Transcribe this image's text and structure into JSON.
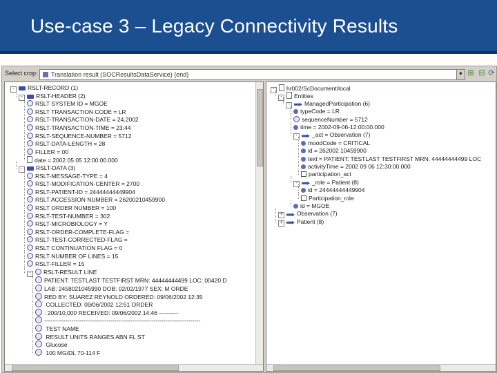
{
  "slide": {
    "title": "Use-case 3 – Legacy Connectivity Results"
  },
  "toolbar": {
    "label": "Select crop:",
    "combo_value": "Translation result (SOCResultsDataService) (end)"
  },
  "left_tree": [
    {
      "text": "RSLT-RECORD (1)",
      "icon": "segment-icon",
      "depth": 0,
      "toggle": "-"
    },
    {
      "text": "RSLT-HEADER (2)",
      "icon": "segment-icon",
      "depth": 1,
      "toggle": "-"
    },
    {
      "text": "RSLT SYSTEM ID = MGOE",
      "icon": "field-icon",
      "depth": 2
    },
    {
      "text": "RSLT TRANSACTION CODE = LR",
      "icon": "field-icon",
      "depth": 2
    },
    {
      "text": "RSLT-TRANSACTION-DATE = 24.2002",
      "icon": "field-icon",
      "depth": 2
    },
    {
      "text": "RSLT-TRANSACTION-TIME = 23:44",
      "icon": "field-icon",
      "depth": 2
    },
    {
      "text": "RSLT-SEQUENCE-NUMBER = 5712",
      "icon": "field-icon",
      "depth": 2
    },
    {
      "text": "RSLT-DATA-LENGTH = 28",
      "icon": "field-icon",
      "depth": 2
    },
    {
      "text": "FILLER =          00",
      "icon": "field-icon",
      "depth": 2
    },
    {
      "text": "date = 2002 05 05 12:00:00.000",
      "icon": "file-icon",
      "depth": 2
    },
    {
      "text": "RSLT-DATA (3)",
      "icon": "segment-icon",
      "depth": 1,
      "toggle": "-"
    },
    {
      "text": "RSLT-MESSAGE-TYPE = 4",
      "icon": "field-icon",
      "depth": 2
    },
    {
      "text": "RSLT-MODIFICATION-CENTER = 2700",
      "icon": "field-icon",
      "depth": 2
    },
    {
      "text": "RSLT-PATIENT-ID = 24444444449904",
      "icon": "field-icon",
      "depth": 2
    },
    {
      "text": "RSLT ACCESSION NUMBER = 26200210459900",
      "icon": "field-icon",
      "depth": 2
    },
    {
      "text": "RSLT ORDER NUMBER = 100",
      "icon": "field-icon",
      "depth": 2
    },
    {
      "text": "RSLT-TEST-NUMBER = 302",
      "icon": "field-icon",
      "depth": 2
    },
    {
      "text": "RSLT-MICROBIOLOGY = Y",
      "icon": "field-icon",
      "depth": 2
    },
    {
      "text": "RSLT-ORDER-COMPLETE-FLAG =",
      "icon": "field-icon",
      "depth": 2
    },
    {
      "text": "RSLT-TEST-CORRECTED-FLAG =",
      "icon": "field-icon",
      "depth": 2
    },
    {
      "text": "RSLT CONTINUATION FLAG = 0",
      "icon": "field-icon",
      "depth": 2
    },
    {
      "text": "RSLT NUMBER OF LINES = 15",
      "icon": "field-icon",
      "depth": 2
    },
    {
      "text": "RSLT-FILLER = 15",
      "icon": "field-icon",
      "depth": 2
    },
    {
      "text": "RSLT-RESULT LINE",
      "icon": "field-icon",
      "depth": 2,
      "toggle": "-"
    },
    {
      "text": "PATIENT: TESTLAST TESTFIRST                MRN: 44444444499 LOC: 00420      D",
      "icon": "ab-icon",
      "depth": 3
    },
    {
      "text": "LAB: 2458021045990          DOB: 02/02/1977 SEX: M          ORDE",
      "icon": "ab-icon",
      "depth": 3
    },
    {
      "text": "RED BY: SUAREZ REYNOLD          ORDERED: 09/06/2002 12:35",
      "icon": "ab-icon",
      "depth": 3
    },
    {
      "text": "                    COLLECTED: 09/06/2002 12:51         ORDER",
      "icon": "ab-icon",
      "depth": 3
    },
    {
      "text": ": 200/10,000                  RECEIVED: 09/06/2002 14:46           ----------",
      "icon": "ab-icon",
      "depth": 3
    },
    {
      "text": "--------------------------------------------------------------------------------",
      "icon": "ab-icon",
      "depth": 3
    },
    {
      "text": "                                       TEST NAME",
      "icon": "ab-icon",
      "depth": 3
    },
    {
      "text": "      RESULT             UNITS   RANGES   ABN FL ST",
      "icon": "ab-icon",
      "depth": 3
    },
    {
      "text": "                                         Glucose",
      "icon": "ab-icon",
      "depth": 3
    },
    {
      "text": "      100              MG/DL   70-114           F",
      "icon": "ab-icon",
      "depth": 3
    }
  ],
  "right_tree": [
    {
      "text": "hr002/ScDocument/local",
      "icon": "file-icon",
      "depth": 0,
      "toggle": "-"
    },
    {
      "text": "Entities",
      "icon": "file-icon",
      "depth": 1,
      "toggle": "-"
    },
    {
      "text": "ManagedParticipation (6)",
      "icon": "arrow-icon",
      "depth": 2,
      "toggle": "-"
    },
    {
      "text": "typeCode = LR",
      "icon": "dot-icon",
      "depth": 3
    },
    {
      "text": "sequenceNumber = 5712",
      "icon": "field-icon",
      "depth": 3
    },
    {
      "text": "time = 2002-09-06-12:00:00.000",
      "icon": "dot-icon",
      "depth": 3
    },
    {
      "text": "_act = Observation (7)",
      "icon": "arrow-icon",
      "depth": 3,
      "toggle": "-"
    },
    {
      "text": "moodCode = CRITICAL",
      "icon": "dot-icon",
      "depth": 4
    },
    {
      "text": "id = 262002 10459900",
      "icon": "dot-icon",
      "depth": 4
    },
    {
      "text": "text = PATIENT: TESTLAST TESTFIRST               MRN: 44444444499 LOC",
      "icon": "dot-icon",
      "depth": 4
    },
    {
      "text": "activityTime = 2002 09 06 12:30:00.000",
      "icon": "dot-icon",
      "depth": 4
    },
    {
      "text": "participation_act",
      "icon": "square-icon",
      "depth": 4
    },
    {
      "text": "_role = Patient (8)",
      "icon": "arrow-icon",
      "depth": 3,
      "toggle": "-"
    },
    {
      "text": "id = 24444444449904",
      "icon": "dot-icon",
      "depth": 4
    },
    {
      "text": "Participation_role",
      "icon": "square-icon",
      "depth": 4
    },
    {
      "text": "id = MGOE",
      "icon": "dot-icon",
      "depth": 3
    },
    {
      "text": "Observation (7)",
      "icon": "arrow-icon",
      "depth": 1,
      "toggle": "+"
    },
    {
      "text": "Patient (8)",
      "icon": "arrow-icon",
      "depth": 1,
      "toggle": "+"
    }
  ]
}
